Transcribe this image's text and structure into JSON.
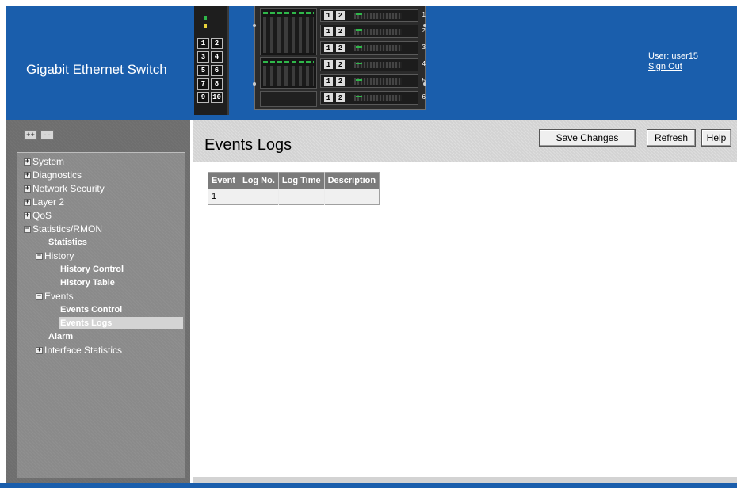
{
  "header": {
    "app_title": "Gigabit Ethernet Switch",
    "user_label": "User: user15",
    "sign_out": "Sign Out",
    "switch_ports": [
      "1",
      "2",
      "3",
      "4",
      "5",
      "6",
      "7",
      "8",
      "9",
      "10"
    ],
    "blades": [
      {
        "a": "1",
        "b": "2",
        "num": "1"
      },
      {
        "a": "1",
        "b": "2",
        "num": "2"
      },
      {
        "a": "1",
        "b": "2",
        "num": "3"
      },
      {
        "a": "1",
        "b": "2",
        "num": "4"
      },
      {
        "a": "1",
        "b": "2",
        "num": "5"
      },
      {
        "a": "1",
        "b": "2",
        "num": "6"
      }
    ]
  },
  "nav": {
    "expand_all": "++",
    "collapse_all": "--",
    "items": [
      {
        "label": "System",
        "expander": "+"
      },
      {
        "label": "Diagnostics",
        "expander": "+"
      },
      {
        "label": "Network Security",
        "expander": "+"
      },
      {
        "label": "Layer 2",
        "expander": "+"
      },
      {
        "label": "QoS",
        "expander": "+"
      },
      {
        "label": "Statistics/RMON",
        "expander": "−"
      },
      {
        "label": "Statistics",
        "expander": ""
      },
      {
        "label": "History",
        "expander": "−"
      },
      {
        "label": "History Control",
        "expander": ""
      },
      {
        "label": "History Table",
        "expander": ""
      },
      {
        "label": "Events",
        "expander": "−"
      },
      {
        "label": "Events Control",
        "expander": ""
      },
      {
        "label": "Events Logs",
        "expander": ""
      },
      {
        "label": "Alarm",
        "expander": ""
      },
      {
        "label": "Interface Statistics",
        "expander": "+"
      }
    ],
    "selected": "Events Logs"
  },
  "main": {
    "title": "Events Logs",
    "buttons": {
      "save": "Save Changes",
      "refresh": "Refresh",
      "help": "Help"
    },
    "table": {
      "columns": [
        "Event",
        "Log No.",
        "Log Time",
        "Description"
      ],
      "rows": [
        [
          "1",
          "",
          "",
          ""
        ]
      ]
    }
  },
  "colors": {
    "header_blue": "#1a5eac",
    "nav_gray": "#8a8a8a",
    "selected_bg": "#d4d4d4"
  }
}
